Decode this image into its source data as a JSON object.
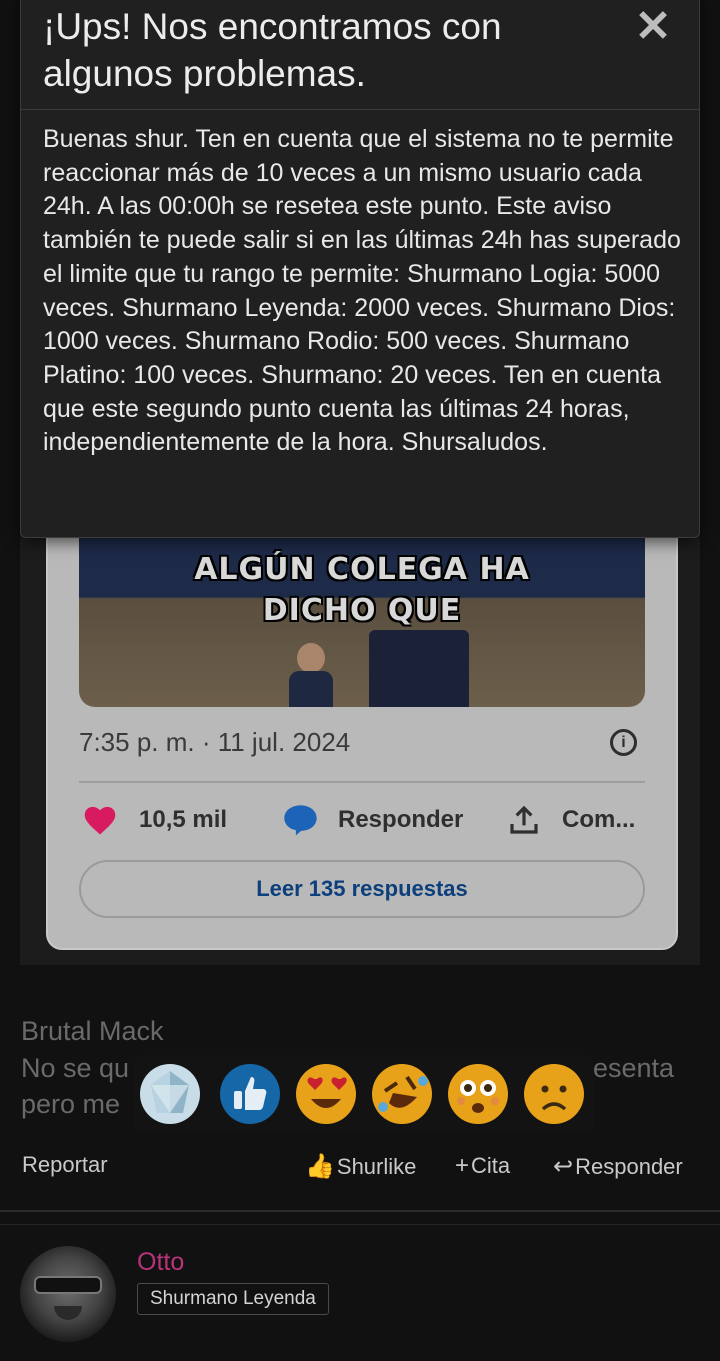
{
  "dialog": {
    "title": "¡Ups! Nos encontramos con algunos problemas.",
    "close_symbol": "✕",
    "message": "Buenas shur. Ten en cuenta que el sistema no te permite reaccionar más de 10 veces a un mismo usuario cada 24h. A las 00:00h se resetea este punto. Este aviso también te puede salir si en las últimas 24h has superado el limite que tu rango te permite: Shurmano Logia: 5000 veces. Shurmano Leyenda: 2000 veces. Shurmano Dios: 1000 veces. Shurmano Rodio: 500 veces. Shurmano Platino: 100 veces. Shurmano: 20 veces. Ten en cuenta que este segundo punto cuenta las últimas 24 horas, independientemente de la hora. Shursaludos."
  },
  "tweet": {
    "media_caption_line1": "ALGÚN COLEGA HA",
    "media_caption_line2": "DICHO QUE",
    "timestamp": "7:35 p. m. · 11 jul. 2024",
    "likes": "10,5 mil",
    "reply_label": "Responder",
    "share_label": "Com...",
    "read_replies": "Leer 135 respuestas",
    "heart_color": "#d81b60",
    "reply_icon_color": "#1d63b8"
  },
  "reply": {
    "author": "Brutal Mack",
    "line1_start": "No se qu",
    "line1_end": "esenta",
    "line2": "pero me"
  },
  "reactions": [
    {
      "name": "diamond-reaction-icon",
      "emoji": "💎"
    },
    {
      "name": "thumbs-up-reaction-icon",
      "emoji": "👍"
    },
    {
      "name": "heart-eyes-reaction-icon",
      "emoji": "😍"
    },
    {
      "name": "rofl-reaction-icon",
      "emoji": "🤣"
    },
    {
      "name": "astonished-reaction-icon",
      "emoji": "😳"
    },
    {
      "name": "sad-reaction-icon",
      "emoji": "☹️"
    }
  ],
  "actions": {
    "report": "Reportar",
    "shurlike": "Shurlike",
    "quote": "Cita",
    "reply": "Responder"
  },
  "next_post": {
    "username": "Otto",
    "rank": "Shurmano Leyenda",
    "username_color": "#b8347a"
  }
}
